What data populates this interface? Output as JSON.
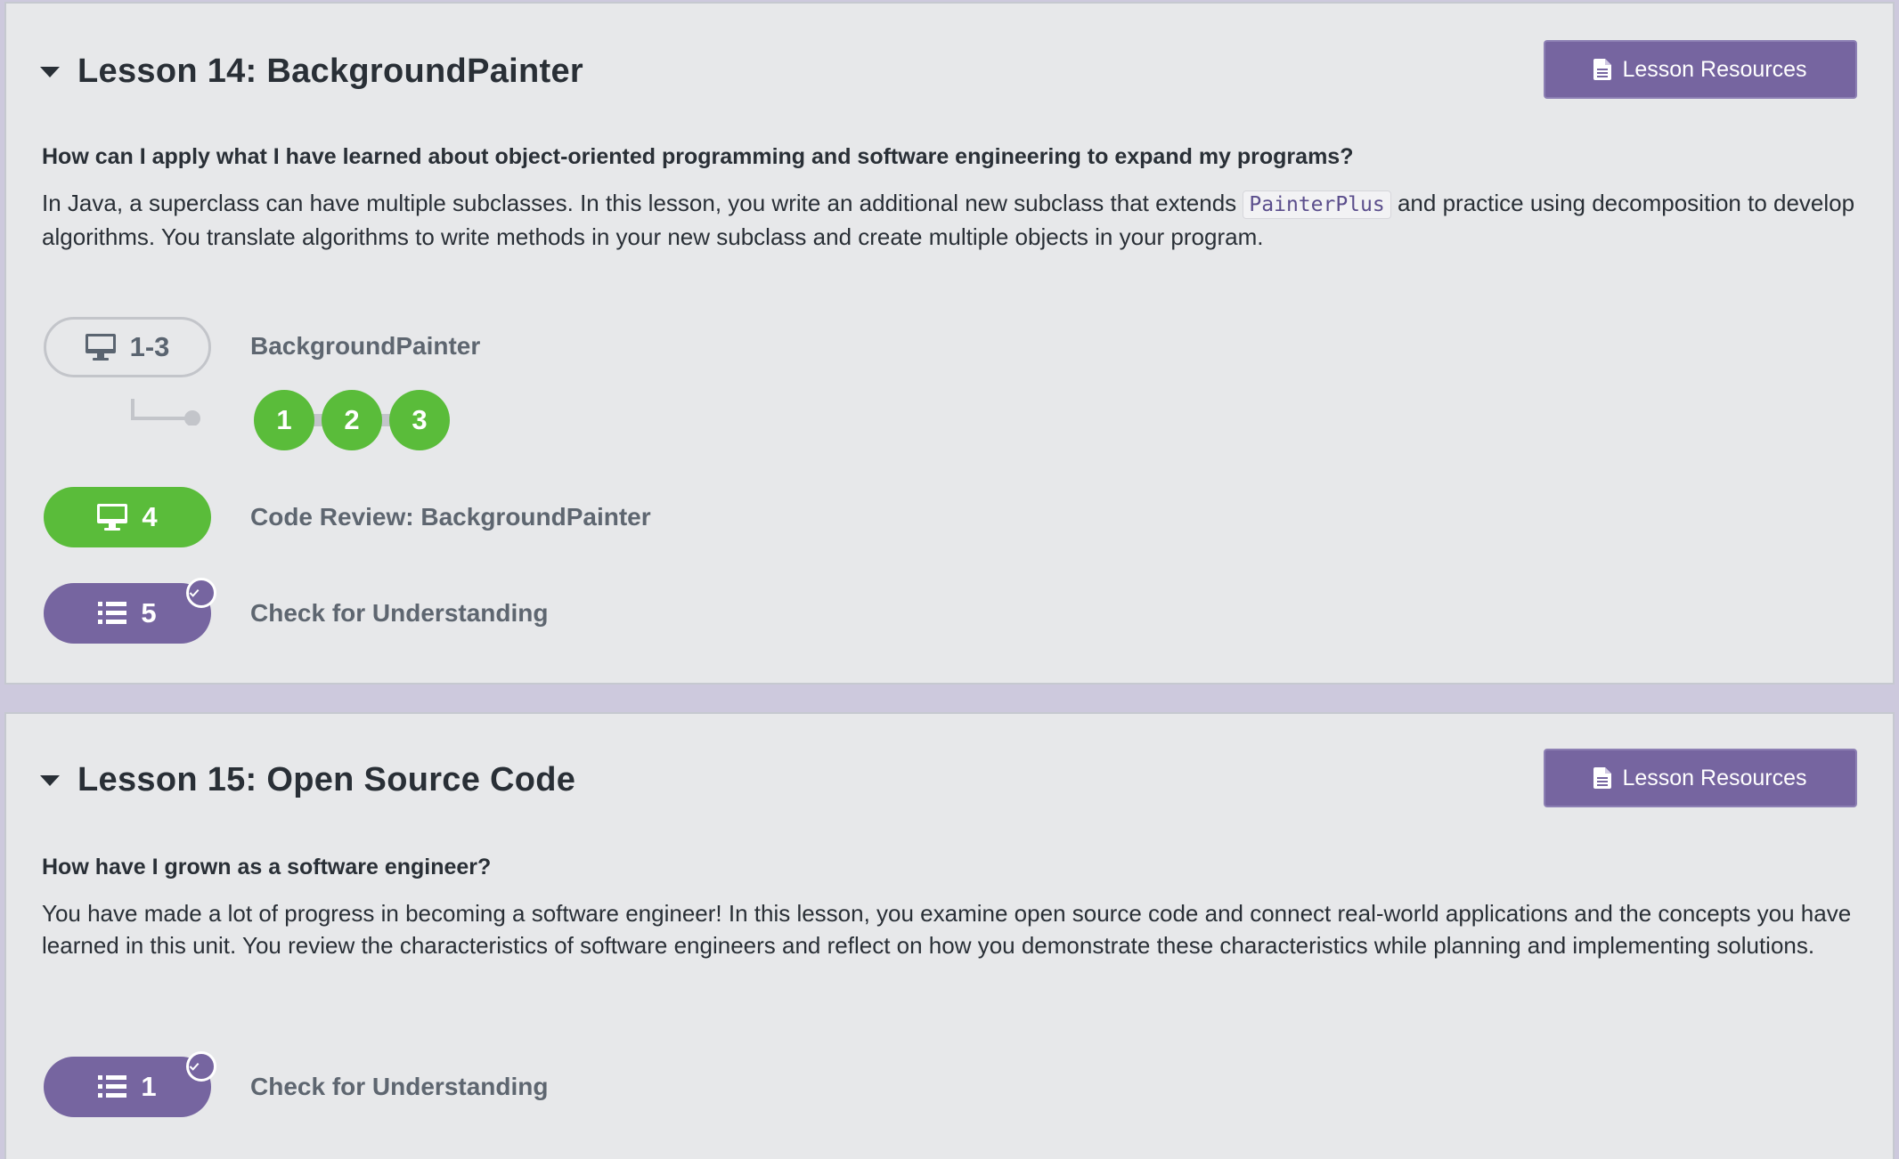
{
  "lessons": [
    {
      "title": "Lesson 14: BackgroundPainter",
      "resources_label": "Lesson Resources",
      "question": "How can I apply what I have learned about object-oriented programming and software engineering to expand my programs?",
      "description_before": "In Java, a superclass can have multiple subclasses. In this lesson, you write an additional new subclass that extends",
      "description_code": "PainterPlus",
      "description_after": "and practice using decomposition to develop algorithms. You translate algorithms to write methods in your new subclass and create multiple objects in your program.",
      "activities": [
        {
          "range": "1-3",
          "label": "BackgroundPainter",
          "icon": "computer-icon",
          "style": "outline",
          "bubbles": [
            "1",
            "2",
            "3"
          ]
        },
        {
          "range": "4",
          "label": "Code Review: BackgroundPainter",
          "icon": "computer-icon",
          "style": "green"
        },
        {
          "range": "5",
          "label": "Check for Understanding",
          "icon": "list-icon",
          "style": "purple",
          "completed": true
        }
      ]
    },
    {
      "title": "Lesson 15: Open Source Code",
      "resources_label": "Lesson Resources",
      "question": "How have I grown as a software engineer?",
      "description": "You have made a lot of progress in becoming a software engineer! In this lesson, you examine open source code and connect real-world applications and the concepts you have learned in this unit. You review the characteristics of software engineers and reflect on how you demonstrate these characteristics while planning and implementing solutions.",
      "activities": [
        {
          "range": "1",
          "label": "Check for Understanding",
          "icon": "list-icon",
          "style": "purple",
          "completed": true
        }
      ]
    }
  ],
  "colors": {
    "purple": "#7665a0",
    "green": "#5abc3a",
    "card_bg": "#e7e8ea",
    "page_bg": "#cdc9dd"
  }
}
